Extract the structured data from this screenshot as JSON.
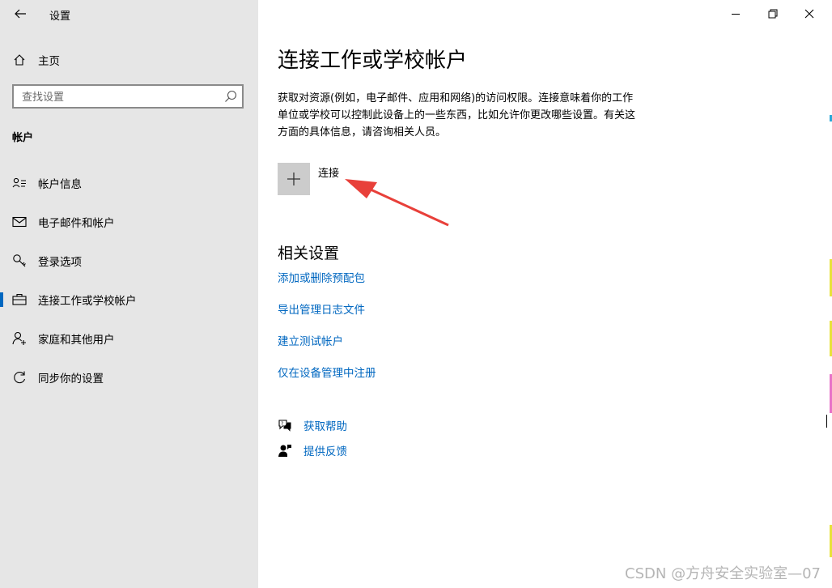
{
  "window": {
    "title": "设置",
    "controls": {
      "minimize": "minimize-icon",
      "maximize": "restore-icon",
      "close": "close-icon"
    }
  },
  "sidebar": {
    "home_label": "主页",
    "search_placeholder": "查找设置",
    "section_header": "帐户",
    "items": [
      {
        "label": "帐户信息",
        "icon": "account-info-icon"
      },
      {
        "label": "电子邮件和帐户",
        "icon": "mail-icon"
      },
      {
        "label": "登录选项",
        "icon": "key-icon"
      },
      {
        "label": "连接工作或学校帐户",
        "icon": "briefcase-icon",
        "selected": true
      },
      {
        "label": "家庭和其他用户",
        "icon": "add-person-icon"
      },
      {
        "label": "同步你的设置",
        "icon": "sync-icon"
      }
    ]
  },
  "main": {
    "title": "连接工作或学校帐户",
    "description": "获取对资源(例如，电子邮件、应用和网络)的访问权限。连接意味着你的工作单位或学校可以控制此设备上的一些东西，比如允许你更改哪些设置。有关这方面的具体信息，请咨询相关人员。",
    "connect_label": "连接",
    "related_title": "相关设置",
    "related_links": [
      "添加或删除预配包",
      "导出管理日志文件",
      "建立测试帐户",
      "仅在设备管理中注册"
    ],
    "help_label": "获取帮助",
    "feedback_label": "提供反馈"
  },
  "watermark": "CSDN @方舟安全实验室—07",
  "colors": {
    "accent": "#0067c0",
    "sidebar_bg": "#e6e6e6",
    "annotation_arrow": "#e8403a"
  }
}
